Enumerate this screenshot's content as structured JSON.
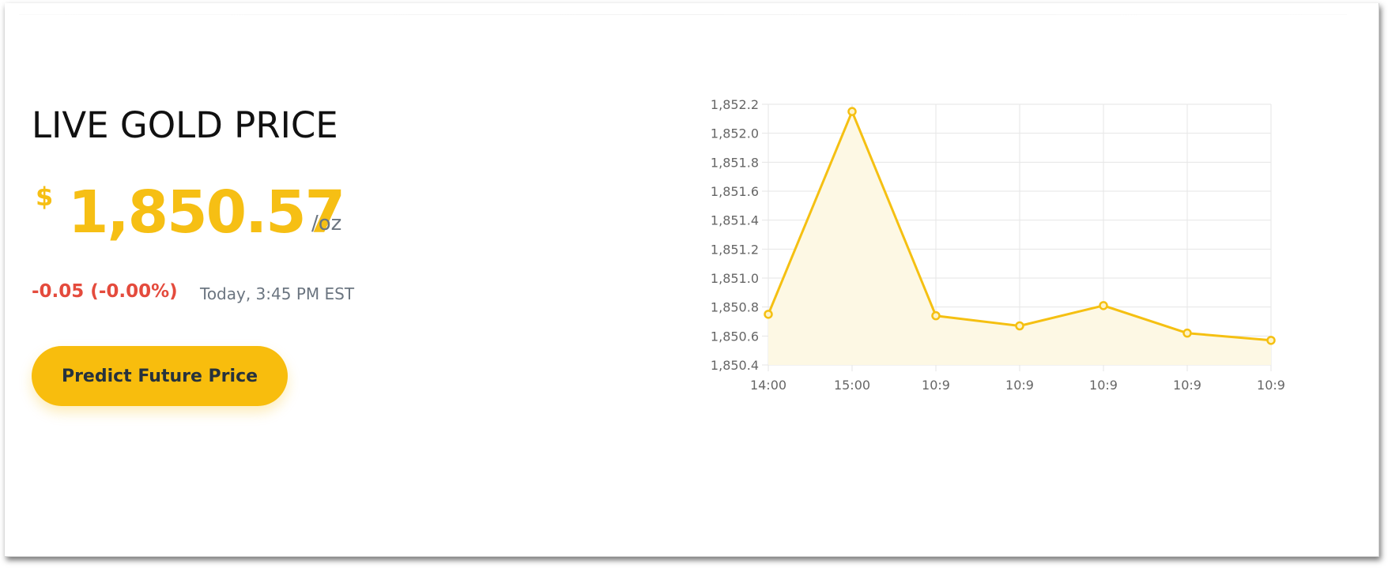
{
  "hero": {
    "title": "LIVE GOLD PRICE",
    "currency_symbol": "$",
    "price": "1,850.57",
    "unit": "/oz",
    "change": "-0.05 (-0.00%)",
    "timestamp": "Today, 3:45 PM EST",
    "predict_button": "Predict Future Price"
  },
  "colors": {
    "accent": "#f8bd0d",
    "negative": "#e44b3d",
    "muted": "#6b7580",
    "line": "#f5c012",
    "fill": "#fdf8e4"
  },
  "chart_data": {
    "type": "area",
    "categories": [
      "14:00",
      "15:00",
      "10:9",
      "10:9",
      "10:9",
      "10:9",
      "10:9"
    ],
    "values": [
      1850.75,
      1852.15,
      1850.74,
      1850.67,
      1850.81,
      1850.62,
      1850.57
    ],
    "ylim": [
      1850.4,
      1852.2
    ],
    "yticks": [
      "1,852.2",
      "1,852.0",
      "1,851.8",
      "1,851.6",
      "1,851.4",
      "1,851.2",
      "1,851.0",
      "1,850.8",
      "1,850.6",
      "1,850.4"
    ],
    "grid": true
  }
}
